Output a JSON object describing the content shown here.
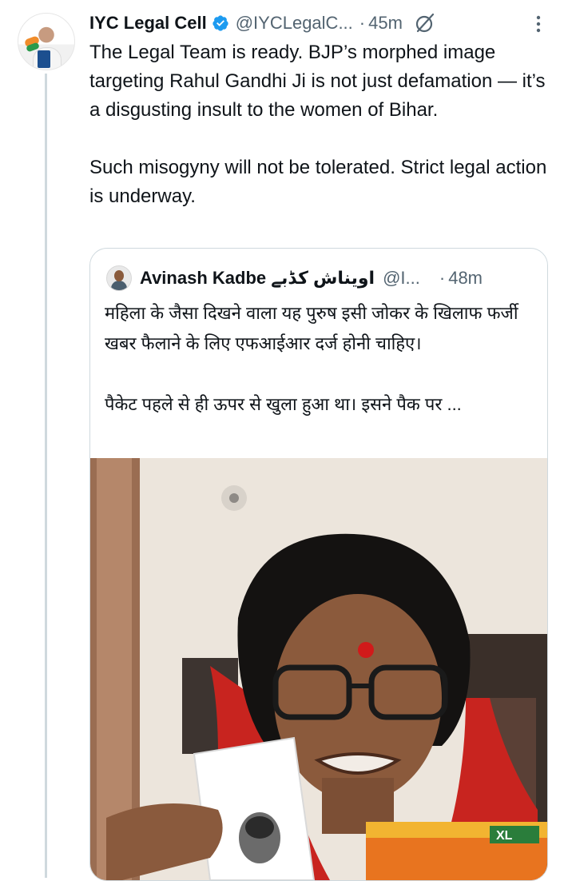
{
  "tweet": {
    "author_name": "IYC Legal Cell",
    "handle": "@IYCLegalC...",
    "separator": "·",
    "time": "45m",
    "paragraphs": [
      "The Legal Team is ready. BJP’s morphed image targeting Rahul Gandhi Ji is not just defamation — it’s a disgusting insult to the women of Bihar.",
      "Such misogyny will not be tolerated. Strict legal action is underway."
    ]
  },
  "quote": {
    "author_name": "Avinash Kadbe اویناش کڈبے",
    "handle": "@I...",
    "separator": "·",
    "time": "48m",
    "paragraphs": [
      "महिला के जैसा दिखने वाला यह पुरुष इसी जोकर के खिलाफ फर्जी खबर फैलाने के लिए एफआईआर दर्ज होनी चाहिए।",
      "पैकेट पहले से ही ऊपर से खुला हुआ था। इसने पैक पर ..."
    ],
    "media_packet_label": "XL"
  },
  "colors": {
    "text_primary": "#0f1419",
    "text_secondary": "#536471",
    "verified_blue": "#1d9bf0",
    "border": "#cfd9de"
  },
  "icons": {
    "verified": "verified-badge-icon",
    "grok": "grok-icon",
    "more": "more-vertical-icon"
  }
}
